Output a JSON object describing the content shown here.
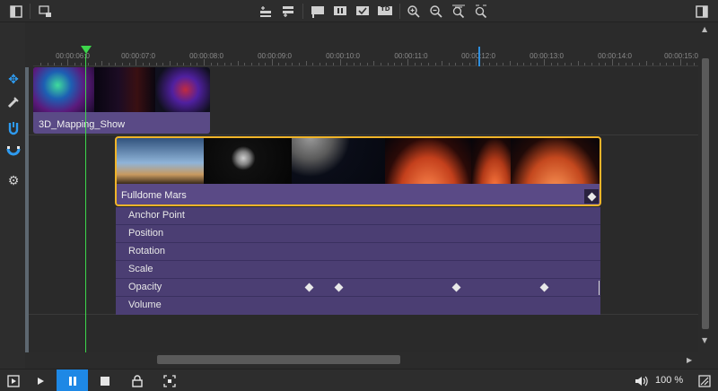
{
  "colors": {
    "clip_purple": "#5a4a86",
    "keyframe_panel": "#4b3e73",
    "selection": "#f0b429",
    "playhead": "#3dd64b",
    "accent_blue": "#1e88e5"
  },
  "toolbar": {
    "icons": [
      "panel-left-icon",
      "layers-icon",
      "insert-track-above-icon",
      "insert-track-below-icon",
      "flag-icon",
      "marker-pause-icon",
      "marker-check-icon",
      "marker-td-icon",
      "zoom-in-icon",
      "zoom-out-icon",
      "zoom-fit-icon",
      "zoom-reset-icon",
      "panel-right-icon"
    ],
    "td_label": "TD"
  },
  "ruler": {
    "ticks": [
      "00:00:06:0",
      "00:00:07:0",
      "00:00:08:0",
      "00:00:09:0",
      "00:00:10:0",
      "00:00:11:0",
      "00:00:12:0",
      "00:00:13:0",
      "00:00:14:0",
      "00:00:15:0"
    ]
  },
  "clips": {
    "clip1": {
      "name": "3D_Mapping_Show"
    },
    "clip2": {
      "name": "Fulldome Mars"
    }
  },
  "keyframes": {
    "rows": [
      "Anchor Point",
      "Position",
      "Rotation",
      "Scale",
      "Opacity",
      "Volume"
    ]
  },
  "bottombar": {
    "zoom": "100 %"
  }
}
